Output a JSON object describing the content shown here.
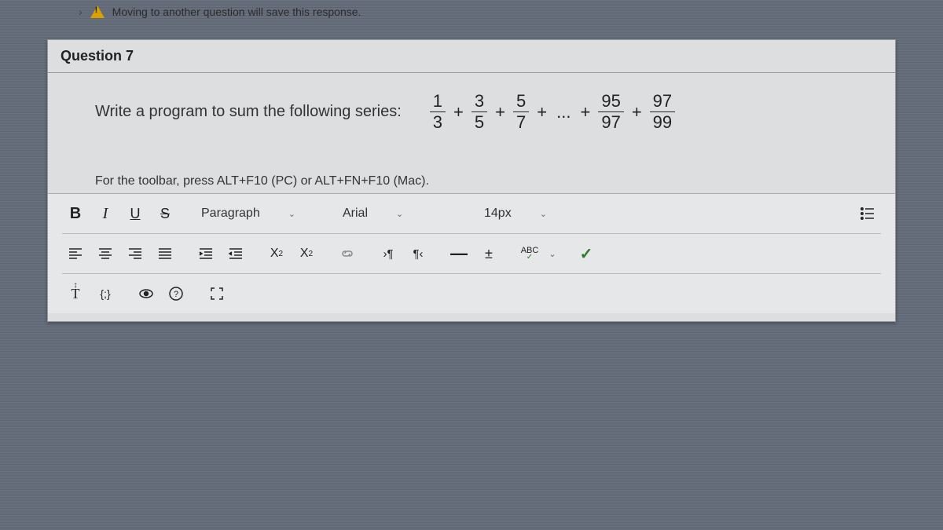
{
  "warning_text": "Moving to another question will save this response.",
  "question_label": "Question 7",
  "prompt_text": "Write a program to sum the following series:",
  "series": {
    "terms": [
      {
        "num": "1",
        "den": "3"
      },
      {
        "num": "3",
        "den": "5"
      },
      {
        "num": "5",
        "den": "7"
      }
    ],
    "tail_terms": [
      {
        "num": "95",
        "den": "97"
      },
      {
        "num": "97",
        "den": "99"
      }
    ],
    "plus": "+",
    "dots": "..."
  },
  "toolbar_hint": "For the toolbar, press ALT+F10 (PC) or ALT+FN+F10 (Mac).",
  "toolbar": {
    "format_select": "Paragraph",
    "font_select": "Arial",
    "size_select": "14px",
    "bold": "B",
    "italic": "I",
    "underline": "U",
    "strike": "S",
    "sup": "X",
    "sup2": "2",
    "sub": "X",
    "sub2": "2",
    "abc": "ABC",
    "check": "✓",
    "T": "T",
    "code": "{;}"
  }
}
